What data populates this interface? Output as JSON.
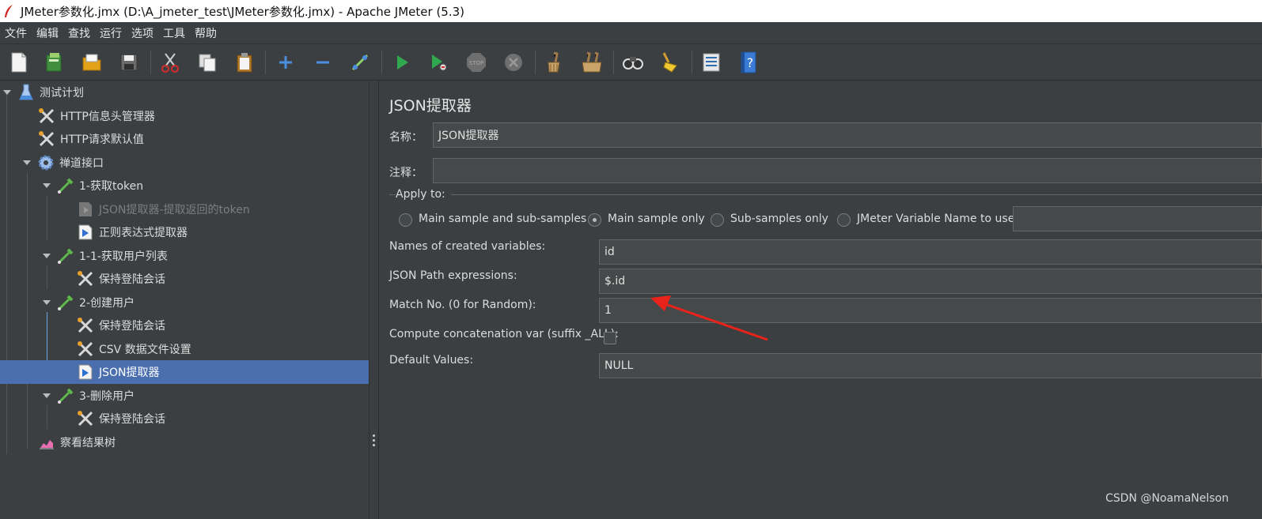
{
  "window": {
    "title": "JMeter参数化.jmx (D:\\A_jmeter_test\\JMeter参数化.jmx) - Apache JMeter (5.3)"
  },
  "menu": [
    "文件",
    "编辑",
    "查找",
    "运行",
    "选项",
    "工具",
    "帮助"
  ],
  "toolbar": {
    "icons": [
      "new-icon",
      "templates-icon",
      "open-icon",
      "save-icon",
      "cut-icon",
      "copy-icon",
      "paste-icon",
      "expand-icon",
      "collapse-icon",
      "toggle-icon",
      "start-icon",
      "start-no-pause-icon",
      "stop-icon",
      "shutdown-icon",
      "clear-icon",
      "clear-all-icon",
      "search-icon",
      "reset-search-icon",
      "function-helper-icon",
      "help-icon"
    ]
  },
  "tree": {
    "nodes": [
      {
        "label": "测试计划",
        "icon": "test-plan-icon",
        "expanded": true
      },
      {
        "label": "HTTP信息头管理器",
        "icon": "config-tool-icon"
      },
      {
        "label": "HTTP请求默认值",
        "icon": "config-tool-icon"
      },
      {
        "label": "禅道接口",
        "icon": "thread-group-icon",
        "expanded": true
      },
      {
        "label": "1-获取token",
        "icon": "sampler-icon",
        "expanded": true
      },
      {
        "label": "JSON提取器-提取返回的token",
        "icon": "post-processor-icon",
        "disabled": true
      },
      {
        "label": "正则表达式提取器",
        "icon": "post-processor-icon"
      },
      {
        "label": "1-1-获取用户列表",
        "icon": "sampler-icon",
        "expanded": true
      },
      {
        "label": "保持登陆会话",
        "icon": "config-tool-icon"
      },
      {
        "label": "2-创建用户",
        "icon": "sampler-icon",
        "expanded": true
      },
      {
        "label": "保持登陆会话",
        "icon": "config-tool-icon"
      },
      {
        "label": "CSV 数据文件设置",
        "icon": "config-tool-icon"
      },
      {
        "label": "JSON提取器",
        "icon": "post-processor-icon",
        "selected": true
      },
      {
        "label": "3-删除用户",
        "icon": "sampler-icon",
        "expanded": true
      },
      {
        "label": "保持登陆会话",
        "icon": "config-tool-icon"
      },
      {
        "label": "察看结果树",
        "icon": "listener-icon"
      }
    ]
  },
  "panel": {
    "title": "JSON提取器",
    "name_label": "名称：",
    "name_value": "JSON提取器",
    "comment_label": "注释：",
    "comment_value": "",
    "apply_to_label": "Apply to:",
    "apply_options": [
      {
        "label": "Main sample and sub-samples",
        "selected": false
      },
      {
        "label": "Main sample only",
        "selected": true
      },
      {
        "label": "Sub-samples only",
        "selected": false
      },
      {
        "label": "JMeter Variable Name to use",
        "selected": false
      }
    ],
    "var_name_value": "",
    "fields": [
      {
        "label": "Names of created variables:",
        "value": "id"
      },
      {
        "label": "JSON Path expressions:",
        "value": "$.id"
      },
      {
        "label": "Match No. (0 for Random):",
        "value": "1"
      },
      {
        "label": "Compute concatenation var (suffix _ALL):",
        "checked": false
      },
      {
        "label": "Default Values:",
        "value": "NULL"
      }
    ]
  },
  "watermark": "CSDN @NoamaNelson",
  "colors": {
    "background": "#3c3f41",
    "selection": "#4b6eaf",
    "annotation_arrow": "#e8231a"
  }
}
